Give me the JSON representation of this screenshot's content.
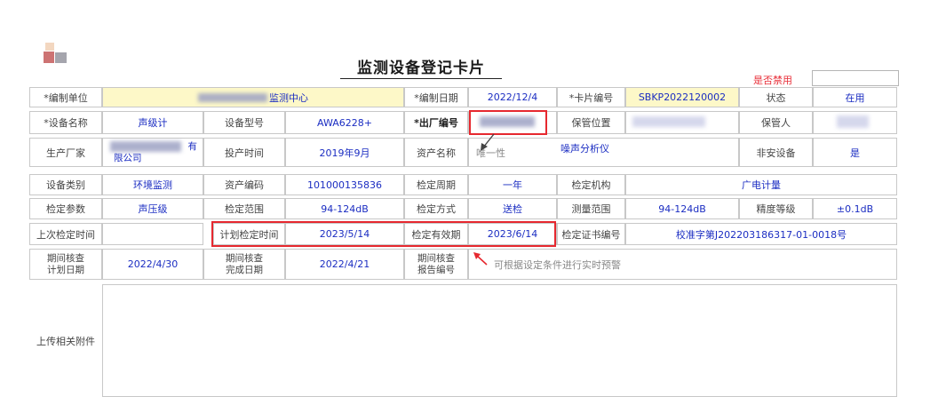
{
  "title": "监测设备登记卡片",
  "jinyong": {
    "label": "是否禁用",
    "value": ""
  },
  "row1": {
    "unit_label": "*编制单位",
    "unit_value": "监测中心",
    "date_label": "*编制日期",
    "date_value": "2022/12/4",
    "card_label": "*卡片编号",
    "card_value": "SBKP2022120002",
    "status_label": "状态",
    "status_value": "在用"
  },
  "row2": {
    "name_label": "*设备名称",
    "name_value": "声级计",
    "model_label": "设备型号",
    "model_value": "AWA6228+",
    "serial_label": "*出厂编号",
    "serial_value": "",
    "location_label": "保管位置",
    "location_value": "",
    "keeper_label": "保管人",
    "keeper_value": ""
  },
  "row3": {
    "maker_label": "生产厂家",
    "maker_value_line1": "有",
    "maker_value_line2": "限公司",
    "start_label": "投产时间",
    "start_value": "2019年9月",
    "asset_name_label": "资产名称",
    "unique_label": "唯一性",
    "asset_name_value": "噪声分析仪",
    "nonsafe_label": "非安设备",
    "nonsafe_value": "是"
  },
  "row4": {
    "category_label": "设备类别",
    "category_value": "环境监测",
    "asset_code_label": "资产编码",
    "asset_code_value": "101000135836",
    "cycle_label": "检定周期",
    "cycle_value": "一年",
    "org_label": "检定机构",
    "org_value": "广电计量"
  },
  "row5": {
    "param_label": "检定参数",
    "param_value": "声压级",
    "range_label": "检定范围",
    "range_value": "94-124dB",
    "method_label": "检定方式",
    "method_value": "送检",
    "measure_label": "测量范围",
    "measure_value": "94-124dB",
    "accuracy_label": "精度等级",
    "accuracy_value": "±0.1dB"
  },
  "row6": {
    "last_label": "上次检定时间",
    "last_value": "",
    "plan_label": "计划检定时间",
    "plan_value": "2023/5/14",
    "valid_label": "检定有效期",
    "valid_value": "2023/6/14",
    "cert_label": "检定证书编号",
    "cert_value": "校准字第J202203186317-01-0018号"
  },
  "row7": {
    "period_plan_label": "期间核查计划日期",
    "period_plan_value": "2022/4/30",
    "period_done_label": "期间核查完成日期",
    "period_done_value": "2022/4/21",
    "report_label": "期间核查报告编号",
    "hint": "可根据设定条件进行实时预警"
  },
  "attach_label": "上传相关附件",
  "colors": {
    "value_text": "#1b2dc2",
    "highlight": "#e6282f",
    "unit_bg": "#fdf8c8"
  }
}
